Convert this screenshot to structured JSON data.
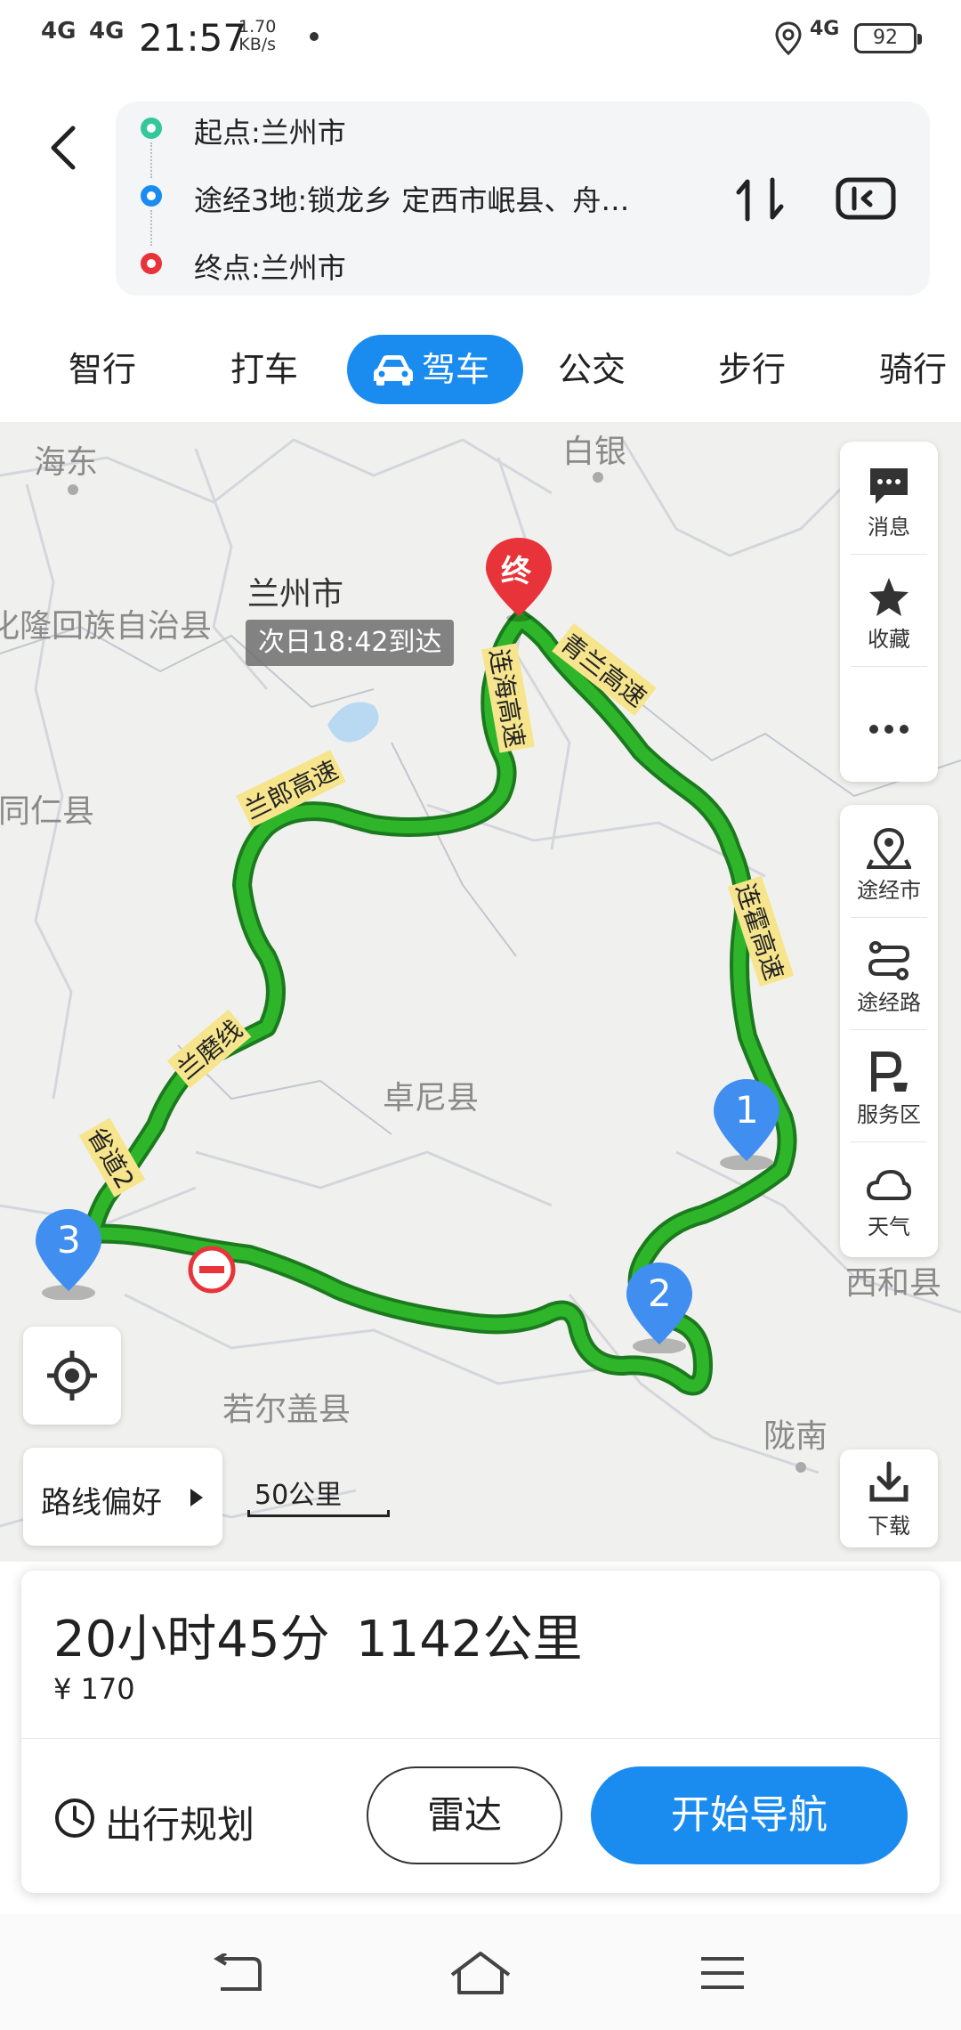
{
  "status_bar": {
    "signal1": "4G",
    "signal2": "4G",
    "time": "21:57",
    "speed_value": "1.70",
    "speed_unit": "KB/s",
    "net_right": "4G",
    "battery": "92"
  },
  "header": {
    "start": "起点:兰州市",
    "via": "途经3地:锁龙乡 定西市岷县、舟…",
    "end": "终点:兰州市"
  },
  "tabs": [
    {
      "label": "智行"
    },
    {
      "label": "打车"
    },
    {
      "label": "驾车"
    },
    {
      "label": "公交"
    },
    {
      "label": "步行"
    },
    {
      "label": "骑行"
    }
  ],
  "map": {
    "places": {
      "haidong": "海东",
      "baiyin": "白银",
      "lanzhou": "兰州市",
      "hualong": "化隆回族自治县",
      "tongren": "同仁县",
      "zhuoni": "卓尼县",
      "xihe": "西和县",
      "longnan": "陇南",
      "ruoergai": "若尔盖县"
    },
    "arrival": "次日18:42到达",
    "end_marker": "终",
    "roads": {
      "lianhai": "连海高速",
      "qinglan": "青兰高速",
      "lanlang": "兰郎高速",
      "lanmo": "兰磨线",
      "sheng": "省道2",
      "lianhuo": "连霍高速"
    },
    "waypoints": [
      "1",
      "2",
      "3"
    ],
    "scale": "50公里"
  },
  "side_tools": {
    "message": "消息",
    "favorite": "收藏",
    "via_city": "途经市",
    "via_road": "途经路",
    "service": "服务区",
    "weather": "天气",
    "download": "下载"
  },
  "route_pref": "路线偏好",
  "summary": {
    "time": "20小时45分",
    "distance": "1142公里",
    "cost": "¥ 170",
    "plan": "出行规划",
    "radar": "雷达",
    "navigate": "开始导航"
  },
  "colors": {
    "accent": "#1a8cf0",
    "route": "#2fb52a",
    "end_marker": "#e8333a",
    "waypoint": "#3f8ef0"
  }
}
